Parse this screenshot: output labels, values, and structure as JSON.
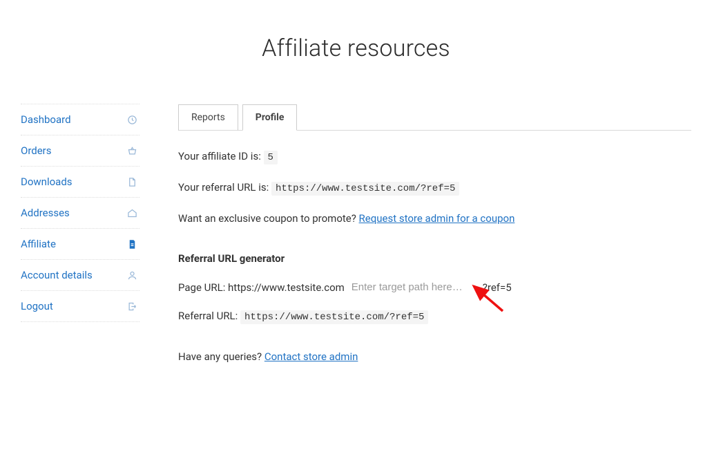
{
  "page_title": "Affiliate resources",
  "sidebar": {
    "items": [
      {
        "label": "Dashboard"
      },
      {
        "label": "Orders"
      },
      {
        "label": "Downloads"
      },
      {
        "label": "Addresses"
      },
      {
        "label": "Affiliate"
      },
      {
        "label": "Account details"
      },
      {
        "label": "Logout"
      }
    ]
  },
  "tabs": {
    "reports": "Reports",
    "profile": "Profile"
  },
  "affiliate": {
    "id_label": "Your affiliate ID is: ",
    "id_value": "5",
    "url_label": "Your referral URL is: ",
    "url_value": "https://www.testsite.com/?ref=5",
    "coupon_prompt": "Want an exclusive coupon to promote? ",
    "coupon_link": "Request store admin for a coupon"
  },
  "generator": {
    "heading": "Referral URL generator",
    "page_label": "Page URL: ",
    "base_url": "https://www.testsite.com",
    "path_placeholder": "Enter target path here…",
    "suffix": "?ref=5",
    "out_label": "Referral URL: ",
    "out_value": "https://www.testsite.com/?ref=5"
  },
  "footer": {
    "prompt": "Have any queries? ",
    "link": "Contact store admin"
  }
}
